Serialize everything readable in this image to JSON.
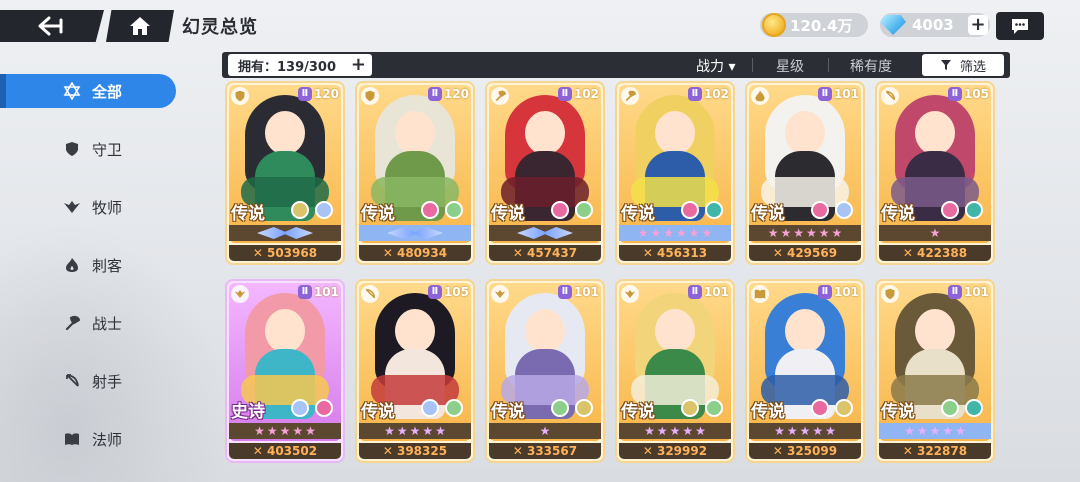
{
  "header": {
    "title": "幻灵总览",
    "gold": "120.4万",
    "gems": "4003",
    "plus_label": "+"
  },
  "sidebar": {
    "items": [
      {
        "label": "全部",
        "icon": "hexagram-icon",
        "active": true
      },
      {
        "label": "守卫",
        "icon": "shield-icon",
        "active": false
      },
      {
        "label": "牧师",
        "icon": "wings-icon",
        "active": false
      },
      {
        "label": "刺客",
        "icon": "flame-icon",
        "active": false
      },
      {
        "label": "战士",
        "icon": "axe-icon",
        "active": false
      },
      {
        "label": "射手",
        "icon": "bow-icon",
        "active": false
      },
      {
        "label": "法师",
        "icon": "book-icon",
        "active": false
      }
    ]
  },
  "filter_bar": {
    "owned": "拥有：139/300",
    "owned_plus": "+",
    "sort_power": "战力 ▾",
    "sort_star": "星级",
    "sort_rarity": "稀有度",
    "filter_label": "筛选"
  },
  "cards": [
    {
      "level": "120",
      "rarity": "传说",
      "power": "503968",
      "stars": 0,
      "band": "wing",
      "hair": "#2b2b34",
      "body": "#2f8a5c",
      "accent": "#1f6b48",
      "class": "shield-icon",
      "e1": "#d9c46a",
      "e2": "#a7c4f5"
    },
    {
      "level": "120",
      "rarity": "传说",
      "power": "480934",
      "stars": 0,
      "band": "wing-blue",
      "hair": "#e8e4d6",
      "body": "#6f9a4a",
      "accent": "#8ab663",
      "class": "shield-icon",
      "e1": "#e96aa0",
      "e2": "#8ccf8a"
    },
    {
      "level": "102",
      "rarity": "传说",
      "power": "457437",
      "stars": 0,
      "band": "wing",
      "hair": "#d6353b",
      "body": "#3a2630",
      "accent": "#6b1f2a",
      "class": "axe-icon",
      "e1": "#e96aa0",
      "e2": "#8ccf8a"
    },
    {
      "level": "102",
      "rarity": "传说",
      "power": "456313",
      "stars": 6,
      "band": "blue",
      "hair": "#f0d060",
      "body": "#2d5da8",
      "accent": "#f2e04a",
      "class": "axe-icon",
      "e1": "#e96aa0",
      "e2": "#3fb6a8"
    },
    {
      "level": "101",
      "rarity": "传说",
      "power": "429569",
      "stars": 6,
      "band": "dark",
      "hair": "#f4f2ee",
      "body": "#2c2c30",
      "accent": "#f7f3ea",
      "class": "flame-icon",
      "e1": "#e96aa0",
      "e2": "#a7c4f5"
    },
    {
      "level": "105",
      "rarity": "传说",
      "power": "422388",
      "stars": 1,
      "band": "dark",
      "hair": "#c0486a",
      "body": "#3a2c44",
      "accent": "#7a5a8a",
      "class": "bow-icon",
      "e1": "#e96aa0",
      "e2": "#3fb6a8"
    },
    {
      "level": "101",
      "rarity": "史诗",
      "power": "403502",
      "stars": 5,
      "band": "dark-pink",
      "hair": "#f39aa8",
      "body": "#3fb6c8",
      "accent": "#f7c850",
      "class": "wings-icon",
      "e1": "#a7c4f5",
      "e2": "#e96aa0"
    },
    {
      "level": "105",
      "rarity": "传说",
      "power": "398325",
      "stars": 5,
      "band": "purple",
      "hair": "#1e1a24",
      "body": "#f3e6dc",
      "accent": "#c43b3b",
      "class": "bow-icon",
      "e1": "#a7c4f5",
      "e2": "#8ccf8a"
    },
    {
      "level": "101",
      "rarity": "传说",
      "power": "333567",
      "stars": 1,
      "band": "purple",
      "hair": "#e6e9f2",
      "body": "#7a6ab0",
      "accent": "#b9a8e6",
      "class": "wings-icon",
      "e1": "#8ccf8a",
      "e2": "#d9c46a"
    },
    {
      "level": "101",
      "rarity": "传说",
      "power": "329992",
      "stars": 5,
      "band": "purple",
      "hair": "#f2d47a",
      "body": "#3b8a4a",
      "accent": "#f4efd8",
      "class": "wings-icon",
      "e1": "#d9c46a",
      "e2": "#8ccf8a"
    },
    {
      "level": "101",
      "rarity": "传说",
      "power": "325099",
      "stars": 5,
      "band": "purple",
      "hair": "#3a7fd6",
      "body": "#f0f0f4",
      "accent": "#2d5da8",
      "class": "book-icon",
      "e1": "#e96aa0",
      "e2": "#d9c46a"
    },
    {
      "level": "101",
      "rarity": "传说",
      "power": "322878",
      "stars": 5,
      "band": "blue-purple",
      "hair": "#6a5a3a",
      "body": "#e8e0c8",
      "accent": "#8a7a4a",
      "class": "shield-icon",
      "e1": "#8ccf8a",
      "e2": "#3fb6a8"
    }
  ],
  "colors": {
    "accent": "#2d86e8",
    "dark_bar": "#23262d",
    "legend_frame": "#f5d58f",
    "epic_frame": "#e9b9f5"
  }
}
